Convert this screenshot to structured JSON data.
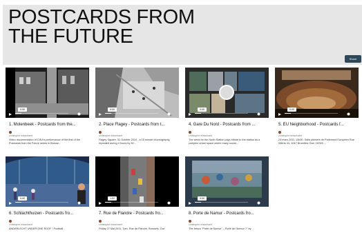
{
  "header": {
    "title_line1": "POSTCARDS FROM",
    "title_line2": "THE FUTURE",
    "share_label": "Share",
    "background": "#e6e6e6"
  },
  "cards": [
    {
      "title": "1. Molenbeek - Postcards from the...",
      "channel": "christophe.misschaert",
      "desc": "Video documentation of CIEA's performance of the first of the Postcards from the Future series in Brusse...",
      "time": "0:00",
      "progress": 0.12,
      "scene": "street"
    },
    {
      "title": "2. Place Flagey - Postcards from t...",
      "channel": "christophe.misschaert",
      "desc": "Flagey Square, 31 October 2010 - a 15 minute choreography, repeated during 4 hours by 40...",
      "time": "0:00",
      "progress": 0.12,
      "scene": "aerial"
    },
    {
      "title": "4. Gare Du Nord - Postcards from ...",
      "channel": "christophe.misschaert",
      "desc": "The week for the North Station pays tribute to the station as a complex urban space where many social...",
      "time": "0:00",
      "progress": 0.12,
      "scene": "collage"
    },
    {
      "title": "5. EU Neighborhood - Postcards f...",
      "channel": "christophe.misschaert",
      "desc": "24 mars 2011, 13h00. Salle plénière du Parlement Européen Rue Wiertz 43, 1047 Bruxelles Over 16'000 ...",
      "time": "0:00",
      "progress": 0.12,
      "scene": "parliament"
    },
    {
      "title": "6. Schlachthuizen - Postcards fro...",
      "channel": "christophe.misschaert",
      "desc": "ANDERLECHT UNDER ONE ROOF ! Football",
      "time": "0:00",
      "progress": 0.12,
      "scene": "hall"
    },
    {
      "title": "7. Rue de Flandre - Postcards fro...",
      "channel": "christophe.misschaert",
      "desc": "Friday 27 Mai 2011, 7pm, Rue de Flandre, Brussels. Our",
      "time": "1:02",
      "progress": 0.12,
      "scene": "road"
    },
    {
      "title": "8. Porte de Namur - Postcards fro...",
      "channel": "christophe.misschaert",
      "desc": "The fresco \"Porte de Namur\" – Porte de l'Amour ?\" by",
      "time": "0:00",
      "progress": 0.12,
      "scene": "mural"
    }
  ]
}
